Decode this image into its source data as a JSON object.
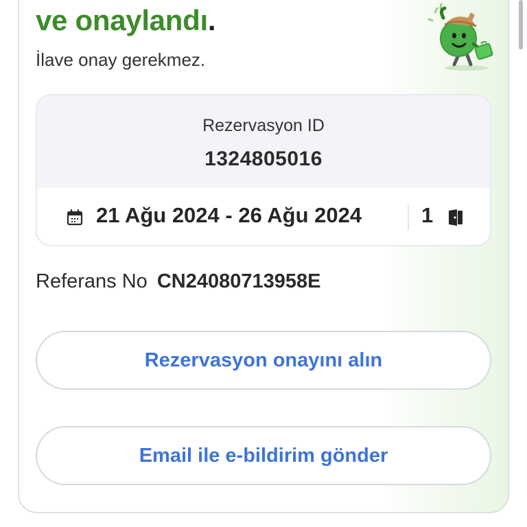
{
  "confirmation": {
    "headline": "ve onaylandı",
    "headline_dot": ".",
    "subline": "İlave onay gerekmez."
  },
  "booking": {
    "id_label": "Rezervasyon ID",
    "id_value": "1324805016",
    "date_range": "21 Ağu 2024 - 26 Ağu 2024",
    "room_count": "1",
    "calendar_icon": "calendar-icon",
    "room_icon": "door-icon"
  },
  "reference": {
    "label": "Referans No",
    "value": "CN24080713958E"
  },
  "actions": {
    "get_confirmation": "Rezervasyon onayını alın",
    "send_email": "Email ile e-bildirim gönder"
  },
  "colors": {
    "headline": "#3d8b2a",
    "action_text": "#3f74d6",
    "card_border": "#dcdfe6"
  },
  "illustration": "mascot-traveler-icon"
}
